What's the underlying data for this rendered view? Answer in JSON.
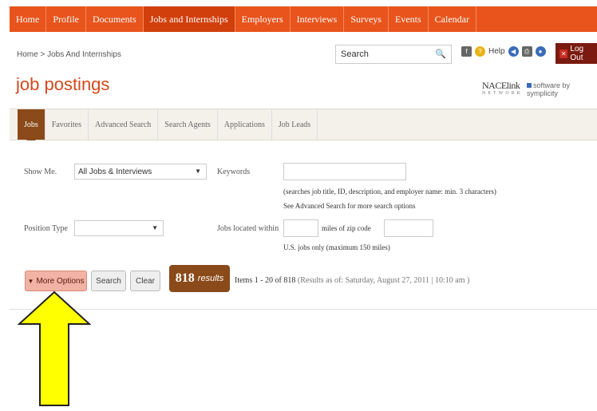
{
  "nav": {
    "items": [
      "Home",
      "Profile",
      "Documents",
      "Jobs and Internships",
      "Employers",
      "Interviews",
      "Surveys",
      "Events",
      "Calendar"
    ],
    "active_index": 3
  },
  "breadcrumb": "Home > Jobs And Internships",
  "search": {
    "value": "Search"
  },
  "toolbar": {
    "help_label": "Help",
    "logout_label": "Log Out"
  },
  "page_title": "job postings",
  "brand": {
    "name": "NACElink",
    "sub": "NETWORK",
    "byline": "software by symplicity"
  },
  "tabs": [
    "Jobs",
    "Favorites",
    "Advanced Search",
    "Search Agents",
    "Applications",
    "Job Leads"
  ],
  "active_tab": 0,
  "form": {
    "show_me_label": "Show Me.",
    "show_me_value": "All Jobs & Interviews",
    "keywords_label": "Keywords",
    "keywords_value": "",
    "keywords_hint": "(searches job title, ID, description, and employer name: min. 3 characters)",
    "advanced_hint": "See Advanced Search for more search options",
    "position_type_label": "Position Type",
    "position_type_value": "",
    "jobs_located_label": "Jobs located within",
    "miles_label": "miles of zip code",
    "us_hint": "U.S. jobs only (maximum 150 miles)"
  },
  "buttons": {
    "more_options": "More Options",
    "search": "Search",
    "clear": "Clear"
  },
  "results": {
    "count": "818",
    "word": "results",
    "items_text": "Items 1 - 20 of 818",
    "as_of": "(Results as of: Saturday, August 27, 2011 | 10:10 am )"
  },
  "colors": {
    "nav": "#e8541c",
    "title": "#d14a1c",
    "tab_active": "#8a4a1a",
    "arrow": "#ffff00"
  }
}
